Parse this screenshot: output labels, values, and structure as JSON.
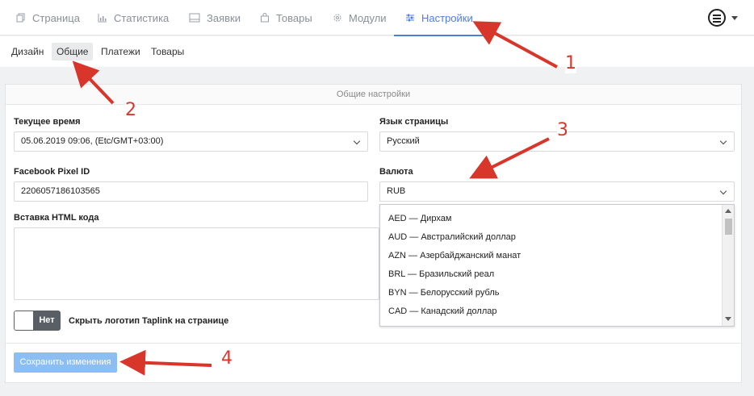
{
  "tabs": [
    {
      "label": "Страница",
      "icon": "page-icon"
    },
    {
      "label": "Статистика",
      "icon": "chart-icon"
    },
    {
      "label": "Заявки",
      "icon": "inbox-icon"
    },
    {
      "label": "Товары",
      "icon": "bag-icon"
    },
    {
      "label": "Модули",
      "icon": "gear-icon"
    },
    {
      "label": "Настройки",
      "icon": "sliders-icon",
      "active": true
    }
  ],
  "subtabs": [
    "Дизайн",
    "Общие",
    "Платежи",
    "Товары"
  ],
  "card": {
    "title": "Общие настройки",
    "time_label": "Текущее время",
    "time_value": "05.06.2019 09:06, (Etc/GMT+03:00)",
    "lang_label": "Язык страницы",
    "lang_value": "Русский",
    "pixel_label": "Facebook Pixel ID",
    "pixel_value": "2206057186103565",
    "currency_label": "Валюта",
    "currency_value": "RUB",
    "html_label": "Вставка HTML кода",
    "toggle_state": "Нет",
    "toggle_label": "Скрыть логотип Taplink на странице",
    "save_label": "Сохранить изменения"
  },
  "currency_options": [
    "AED — Дирхам",
    "AUD — Австралийский доллар",
    "AZN — Азербайджанский манат",
    "BRL — Бразильский реал",
    "BYN — Белорусский рубль",
    "CAD — Канадский доллар"
  ],
  "annotations": [
    "1",
    "2",
    "3",
    "4"
  ],
  "colors": {
    "accent": "#4d7fd6",
    "arrow": "#d9362b",
    "save_button": "#8dbef3"
  }
}
